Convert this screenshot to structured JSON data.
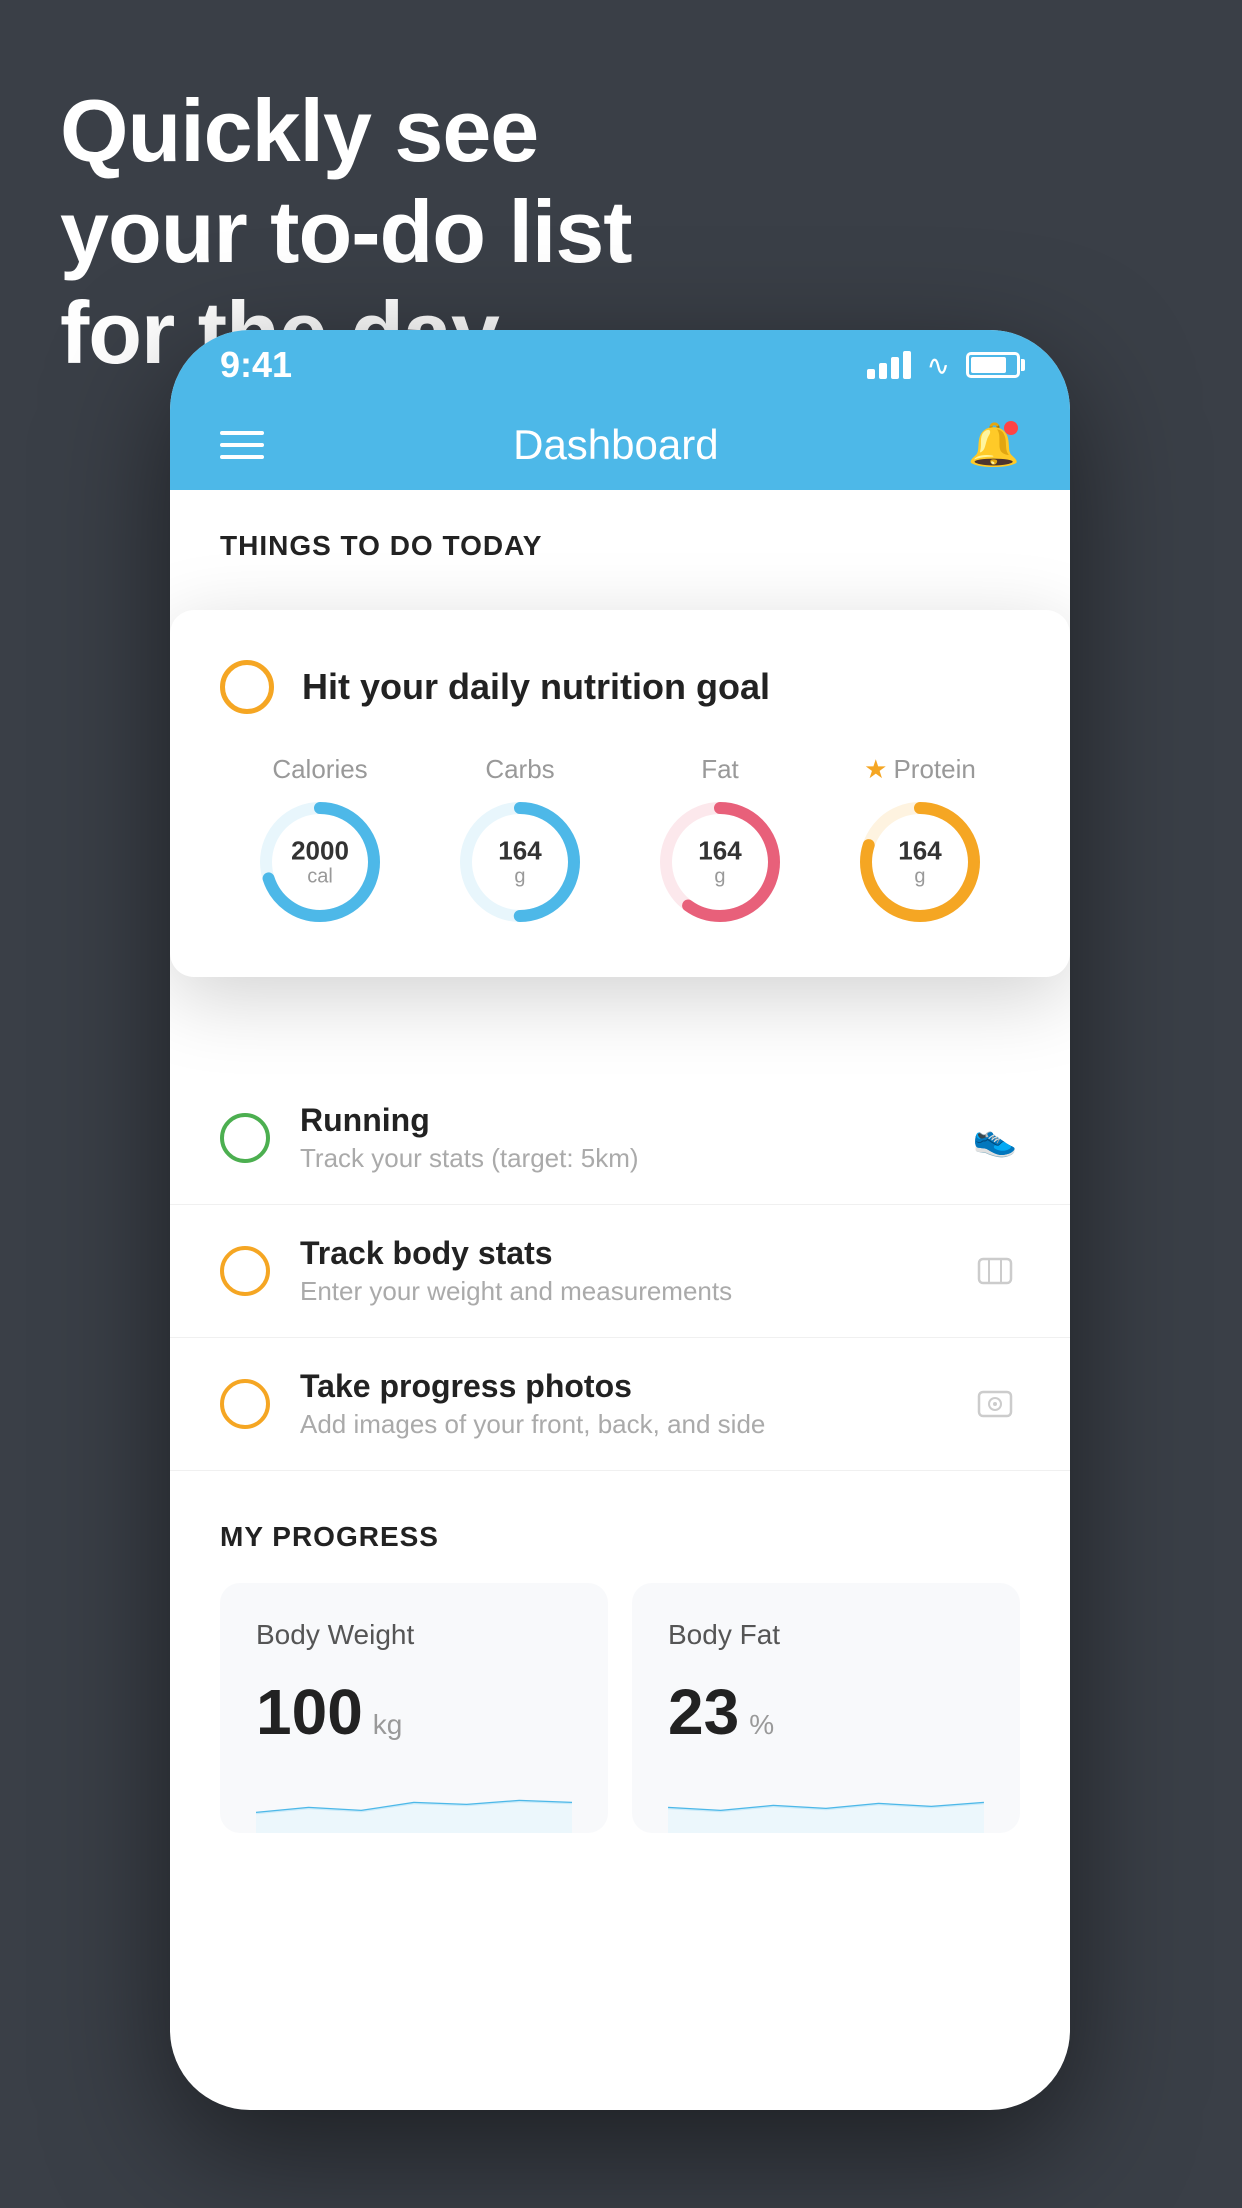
{
  "hero": {
    "line1": "Quickly see",
    "line2": "your to-do list",
    "line3": "for the day."
  },
  "status_bar": {
    "time": "9:41"
  },
  "nav": {
    "title": "Dashboard"
  },
  "section": {
    "things_to_do": "THINGS TO DO TODAY"
  },
  "floating_card": {
    "title": "Hit your daily nutrition goal",
    "nutrition": [
      {
        "label": "Calories",
        "value": "2000",
        "unit": "cal",
        "color": "#4db8e8",
        "track": 0.7
      },
      {
        "label": "Carbs",
        "value": "164",
        "unit": "g",
        "color": "#4db8e8",
        "track": 0.5
      },
      {
        "label": "Fat",
        "value": "164",
        "unit": "g",
        "color": "#e8607a",
        "track": 0.6
      },
      {
        "label": "Protein",
        "value": "164",
        "unit": "g",
        "color": "#f5a623",
        "track": 0.8,
        "starred": true
      }
    ]
  },
  "todo_items": [
    {
      "title": "Running",
      "subtitle": "Track your stats (target: 5km)",
      "circle_color": "green",
      "icon": "👟"
    },
    {
      "title": "Track body stats",
      "subtitle": "Enter your weight and measurements",
      "circle_color": "yellow",
      "icon": "⚖"
    },
    {
      "title": "Take progress photos",
      "subtitle": "Add images of your front, back, and side",
      "circle_color": "yellow",
      "icon": "🪪"
    }
  ],
  "progress": {
    "section_title": "MY PROGRESS",
    "cards": [
      {
        "title": "Body Weight",
        "value": "100",
        "unit": "kg"
      },
      {
        "title": "Body Fat",
        "value": "23",
        "unit": "%"
      }
    ]
  }
}
